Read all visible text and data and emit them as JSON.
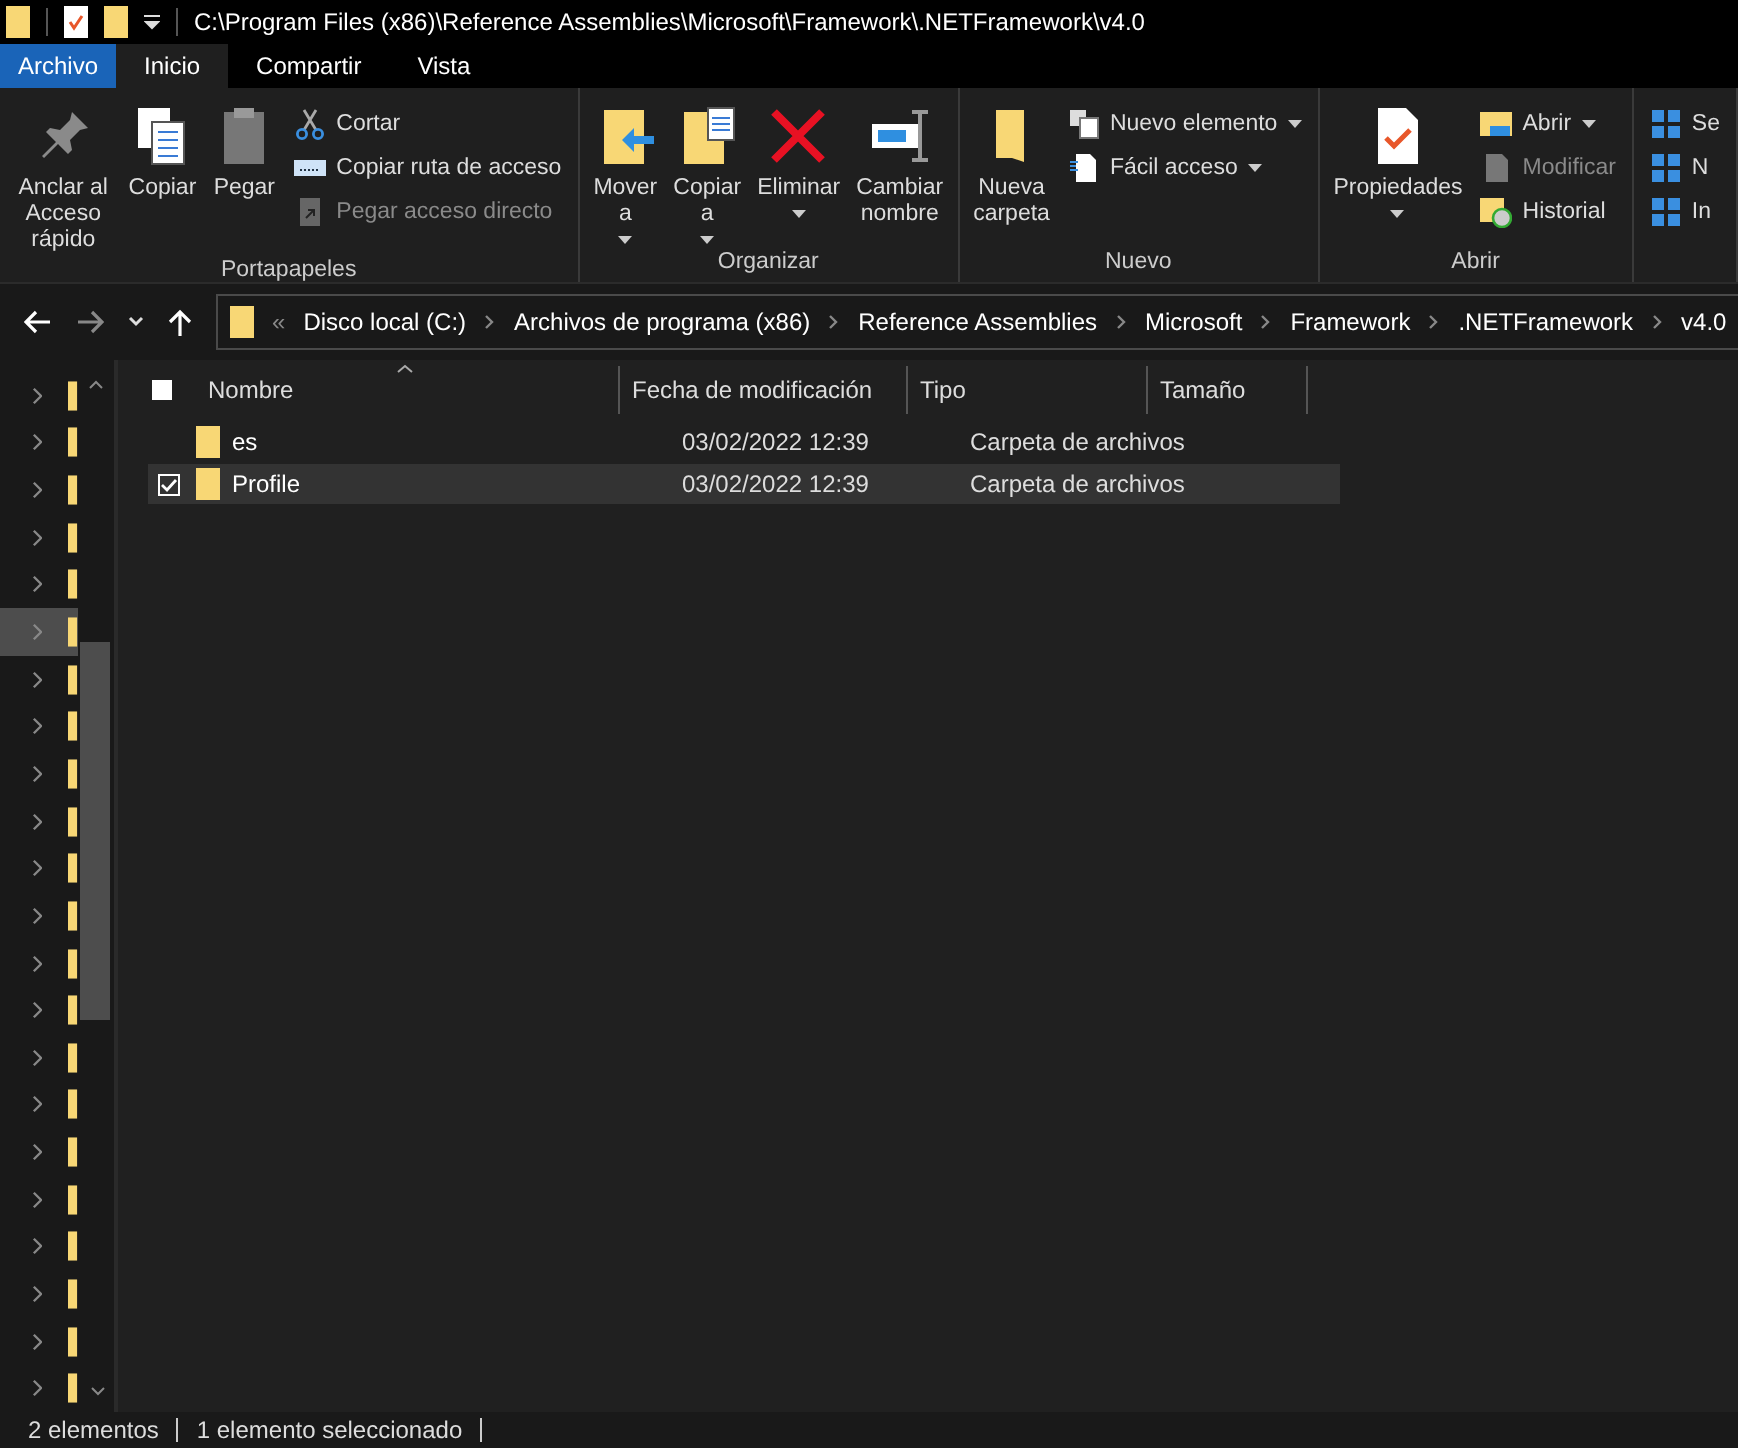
{
  "title_bar": {
    "path": "C:\\Program Files (x86)\\Reference Assemblies\\Microsoft\\Framework\\.NETFramework\\v4.0"
  },
  "tabs": [
    {
      "label": "Archivo",
      "kind": "file",
      "selected": false
    },
    {
      "label": "Inicio",
      "kind": "tab",
      "selected": true
    },
    {
      "label": "Compartir",
      "kind": "tab",
      "selected": false
    },
    {
      "label": "Vista",
      "kind": "tab",
      "selected": false
    }
  ],
  "ribbon": {
    "groups": [
      {
        "label": "Portapapeles",
        "large": [
          {
            "label": "Anclar al\nAcceso rápido",
            "dropdown": false
          },
          {
            "label": "Copiar",
            "dropdown": false
          },
          {
            "label": "Pegar",
            "dropdown": false
          }
        ],
        "small": [
          {
            "label": "Cortar",
            "dropdown": false,
            "disabled": false
          },
          {
            "label": "Copiar ruta de acceso",
            "dropdown": false,
            "disabled": false
          },
          {
            "label": "Pegar acceso directo",
            "dropdown": false,
            "disabled": true
          }
        ]
      },
      {
        "label": "Organizar",
        "large": [
          {
            "label": "Mover\na",
            "dropdown": true
          },
          {
            "label": "Copiar\na",
            "dropdown": true
          },
          {
            "label": "Eliminar",
            "dropdown": true
          },
          {
            "label": "Cambiar\nnombre",
            "dropdown": false
          }
        ]
      },
      {
        "label": "Nuevo",
        "large": [
          {
            "label": "Nueva\ncarpeta",
            "dropdown": false
          }
        ],
        "small": [
          {
            "label": "Nuevo elemento",
            "dropdown": true,
            "disabled": false
          },
          {
            "label": "Fácil acceso",
            "dropdown": true,
            "disabled": false
          }
        ]
      },
      {
        "label": "Abrir",
        "large": [
          {
            "label": "Propiedades",
            "dropdown": true
          }
        ],
        "small": [
          {
            "label": "Abrir",
            "dropdown": true,
            "disabled": false
          },
          {
            "label": "Modificar",
            "dropdown": false,
            "disabled": true
          },
          {
            "label": "Historial",
            "dropdown": false,
            "disabled": false
          }
        ]
      },
      {
        "small": [
          {
            "label": "Se",
            "dropdown": false,
            "disabled": false
          },
          {
            "label": "N",
            "dropdown": false,
            "disabled": false
          },
          {
            "label": "In",
            "dropdown": false,
            "disabled": false
          }
        ]
      }
    ]
  },
  "address": {
    "overflow": "«",
    "crumbs": [
      "Disco local (C:)",
      "Archivos de programa (x86)",
      "Reference Assemblies",
      "Microsoft",
      "Framework",
      ".NETFramework",
      "v4.0"
    ]
  },
  "nav_items": [
    {
      "selected": false
    },
    {
      "selected": false
    },
    {
      "selected": false
    },
    {
      "selected": false
    },
    {
      "selected": false
    },
    {
      "selected": true
    },
    {
      "selected": false
    },
    {
      "selected": false
    },
    {
      "selected": false
    },
    {
      "selected": false
    },
    {
      "selected": false
    },
    {
      "selected": false
    },
    {
      "selected": false
    },
    {
      "selected": false
    },
    {
      "selected": false
    },
    {
      "selected": false
    },
    {
      "selected": false
    },
    {
      "selected": false
    },
    {
      "selected": false
    },
    {
      "selected": false
    },
    {
      "selected": false
    },
    {
      "selected": false
    }
  ],
  "table": {
    "all_checked": false,
    "columns": [
      "Nombre",
      "Fecha de modificación",
      "Tipo",
      "Tamaño"
    ],
    "rows": [
      {
        "name": "es",
        "date": "03/02/2022 12:39",
        "type": "Carpeta de archivos",
        "selected": false,
        "checked": false
      },
      {
        "name": "Profile",
        "date": "03/02/2022 12:39",
        "type": "Carpeta de archivos",
        "selected": true,
        "checked": true
      }
    ]
  },
  "status_bar": [
    "2 elementos",
    "1 elemento seleccionado"
  ]
}
